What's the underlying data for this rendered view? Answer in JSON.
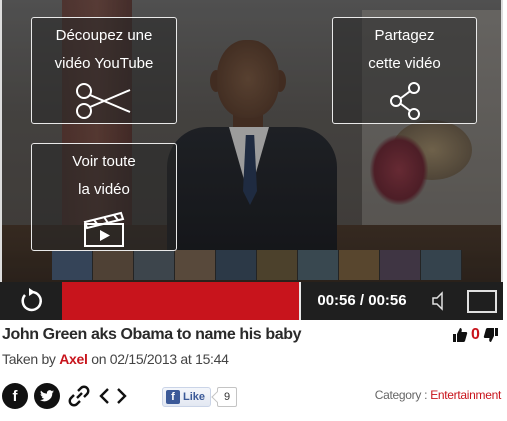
{
  "overlay": {
    "cut": {
      "line1": "Découpez une",
      "line2": "vidéo YouTube",
      "icon": "scissors-icon"
    },
    "share": {
      "line1": "Partagez",
      "line2": "cette vidéo",
      "icon": "share-nodes-icon"
    },
    "full": {
      "line1": "Voir toute",
      "line2": "la vidéo",
      "icon": "clapperboard-icon"
    }
  },
  "player": {
    "time_display": "00:56 / 00:56",
    "progress": 1.0,
    "icons": {
      "replay": "replay-icon",
      "volume": "volume-icon",
      "fullscreen": "fullscreen-icon"
    }
  },
  "video": {
    "title": "John Green aks Obama to name his baby",
    "taken_by_prefix": "Taken by",
    "author": "Axel",
    "date_text": "on 02/15/2013 at 15:44",
    "vote_count": "0"
  },
  "share": {
    "icons": [
      "facebook-icon",
      "twitter-icon",
      "link-icon",
      "embed-code-icon"
    ],
    "facebook_like_label": "Like",
    "facebook_like_count": "9"
  },
  "category": {
    "prefix": "Category :",
    "name": "Entertainment"
  },
  "colors": {
    "accent": "#c8141c",
    "control_bar": "#1f1f1f",
    "facebook": "#3b5998"
  }
}
